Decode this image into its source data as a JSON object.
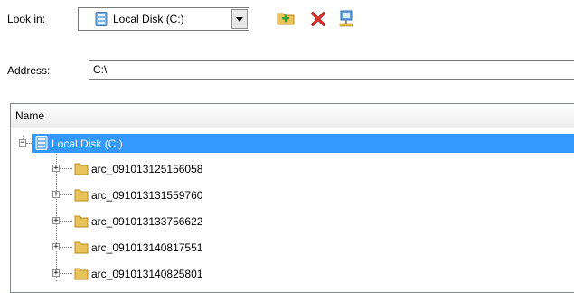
{
  "toolbar": {
    "look_in_label": "Look in:",
    "look_in_value": "Local Disk (C:)",
    "new_folder_icon": "new-folder-icon",
    "delete_icon": "delete-icon",
    "network_icon": "network-drive-icon"
  },
  "address": {
    "label": "Address:",
    "value": "C:\\"
  },
  "tree": {
    "column_header": "Name",
    "root": {
      "label": "Local Disk (C:)",
      "selected": true,
      "expanded": true
    },
    "items": [
      {
        "label": "arc_091013125156058"
      },
      {
        "label": "arc_091013131559760"
      },
      {
        "label": "arc_091013133756622"
      },
      {
        "label": "arc_091013140817551"
      },
      {
        "label": "arc_091013140825801"
      }
    ]
  },
  "colors": {
    "selection": "#3399ff",
    "folder": "#e8c25a",
    "delete": "#e0322e"
  }
}
